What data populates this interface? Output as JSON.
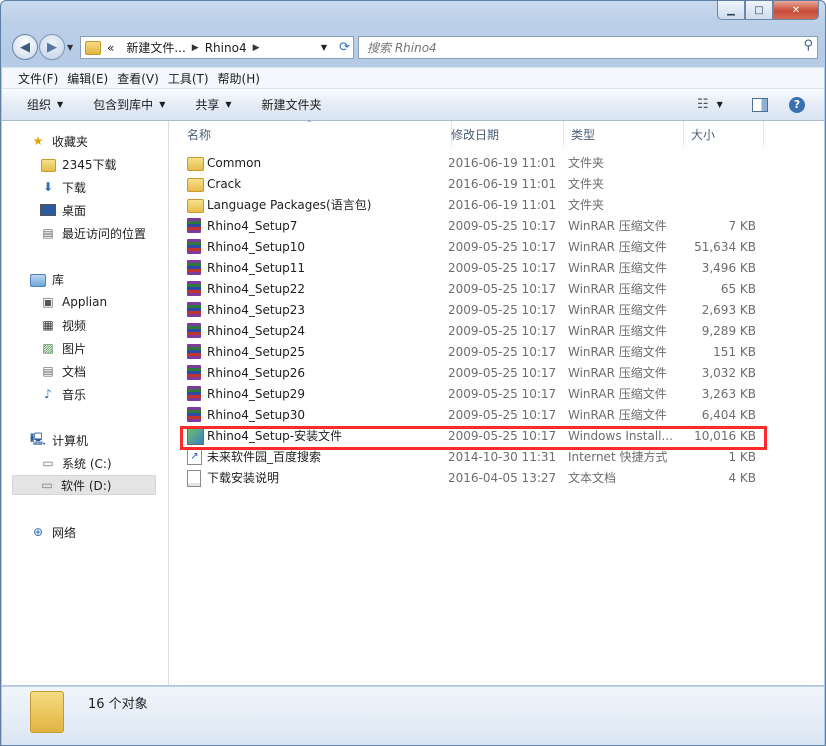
{
  "address": {
    "segments": [
      "«",
      "新建文件...",
      "Rhino4"
    ]
  },
  "search": {
    "placeholder": "搜索 Rhino4"
  },
  "menu": [
    "文件(F)",
    "编辑(E)",
    "查看(V)",
    "工具(T)",
    "帮助(H)"
  ],
  "toolbar": {
    "organize": "组织",
    "include_library": "包含到库中",
    "share": "共享",
    "new_folder": "新建文件夹"
  },
  "nav": {
    "favorites_header": "收藏夹",
    "favorites": [
      "2345下载",
      "下载",
      "桌面",
      "最近访问的位置"
    ],
    "libraries_header": "库",
    "libraries": [
      "Applian",
      "视频",
      "图片",
      "文档",
      "音乐"
    ],
    "computer_header": "计算机",
    "drives": [
      "系统 (C:)",
      "软件 (D:)"
    ],
    "network_header": "网络"
  },
  "columns": {
    "name": "名称",
    "date": "修改日期",
    "type": "类型",
    "size": "大小"
  },
  "files": [
    {
      "name": "Common",
      "date": "2016-06-19 11:01",
      "type": "文件夹",
      "size": "",
      "icon": "folder"
    },
    {
      "name": "Crack",
      "date": "2016-06-19 11:01",
      "type": "文件夹",
      "size": "",
      "icon": "folder"
    },
    {
      "name": "Language Packages(语言包)",
      "date": "2016-06-19 11:01",
      "type": "文件夹",
      "size": "",
      "icon": "folder"
    },
    {
      "name": "Rhino4_Setup7",
      "date": "2009-05-25 10:17",
      "type": "WinRAR 压缩文件",
      "size": "7 KB",
      "icon": "rar"
    },
    {
      "name": "Rhino4_Setup10",
      "date": "2009-05-25 10:17",
      "type": "WinRAR 压缩文件",
      "size": "51,634 KB",
      "icon": "rar"
    },
    {
      "name": "Rhino4_Setup11",
      "date": "2009-05-25 10:17",
      "type": "WinRAR 压缩文件",
      "size": "3,496 KB",
      "icon": "rar"
    },
    {
      "name": "Rhino4_Setup22",
      "date": "2009-05-25 10:17",
      "type": "WinRAR 压缩文件",
      "size": "65 KB",
      "icon": "rar"
    },
    {
      "name": "Rhino4_Setup23",
      "date": "2009-05-25 10:17",
      "type": "WinRAR 压缩文件",
      "size": "2,693 KB",
      "icon": "rar"
    },
    {
      "name": "Rhino4_Setup24",
      "date": "2009-05-25 10:17",
      "type": "WinRAR 压缩文件",
      "size": "9,289 KB",
      "icon": "rar"
    },
    {
      "name": "Rhino4_Setup25",
      "date": "2009-05-25 10:17",
      "type": "WinRAR 压缩文件",
      "size": "151 KB",
      "icon": "rar"
    },
    {
      "name": "Rhino4_Setup26",
      "date": "2009-05-25 10:17",
      "type": "WinRAR 压缩文件",
      "size": "3,032 KB",
      "icon": "rar"
    },
    {
      "name": "Rhino4_Setup29",
      "date": "2009-05-25 10:17",
      "type": "WinRAR 压缩文件",
      "size": "3,263 KB",
      "icon": "rar"
    },
    {
      "name": "Rhino4_Setup30",
      "date": "2009-05-25 10:17",
      "type": "WinRAR 压缩文件",
      "size": "6,404 KB",
      "icon": "rar"
    },
    {
      "name": "Rhino4_Setup-安装文件",
      "date": "2009-05-25 10:17",
      "type": "Windows Install...",
      "size": "10,016 KB",
      "icon": "msi"
    },
    {
      "name": "未来软件园_百度搜索",
      "date": "2014-10-30 11:31",
      "type": "Internet 快捷方式",
      "size": "1 KB",
      "icon": "url"
    },
    {
      "name": "下载安装说明",
      "date": "2016-04-05 13:27",
      "type": "文本文档",
      "size": "4 KB",
      "icon": "txt"
    }
  ],
  "status": {
    "count": "16 个对象"
  },
  "colors": {
    "highlight_border": "#ff2a2a",
    "window_frame": "#b5cbe6"
  }
}
